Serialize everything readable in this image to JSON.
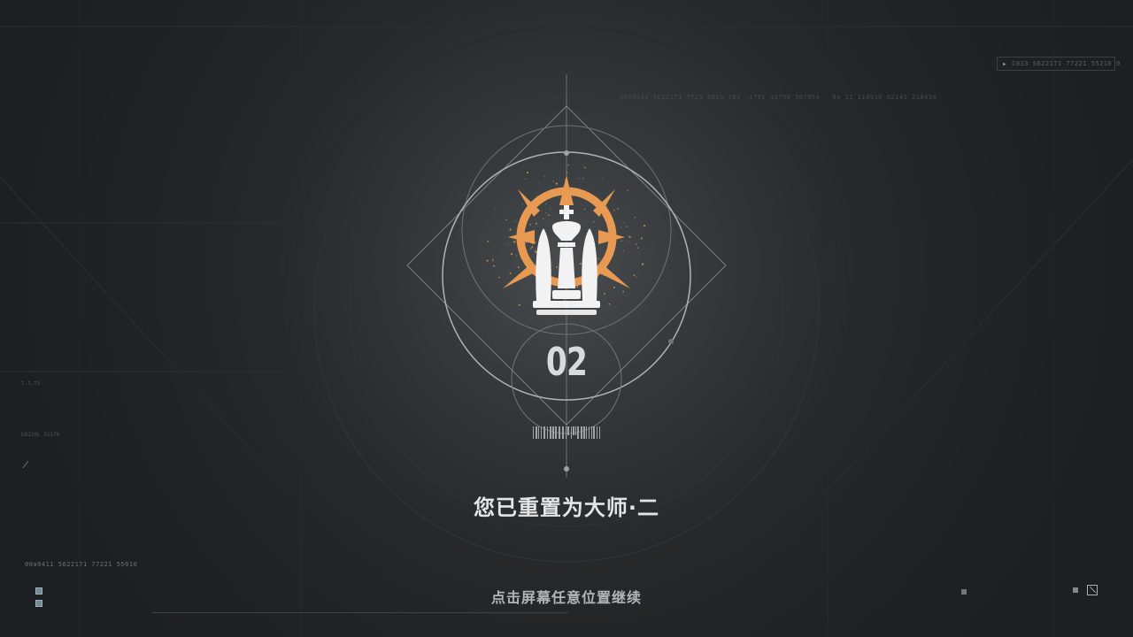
{
  "rank": {
    "number": "02",
    "title": "您已重置为大师·二",
    "badge_icon": "chess-king-compass-badge"
  },
  "prompt": {
    "continue": "点击屏幕任意位置继续"
  },
  "decor": {
    "top_code": "0000411 5622171 7725 5010 103 -1791 13790 507954 · 04 11 114910 02141 218430",
    "top_right_code": "C033 5622171 77221 55210 0",
    "bottom_left_code": "00a0411 5622171 77221 55010",
    "left_readout_1": "t.t.t5",
    "left_readout_2": "b8220L 5517H"
  },
  "colors": {
    "badge_orange": "#e89a52",
    "badge_white": "#f2f2f2",
    "ring_gray": "#8f9497",
    "text_white": "#e3e4e5",
    "hint_gray": "#b2b5b7"
  }
}
